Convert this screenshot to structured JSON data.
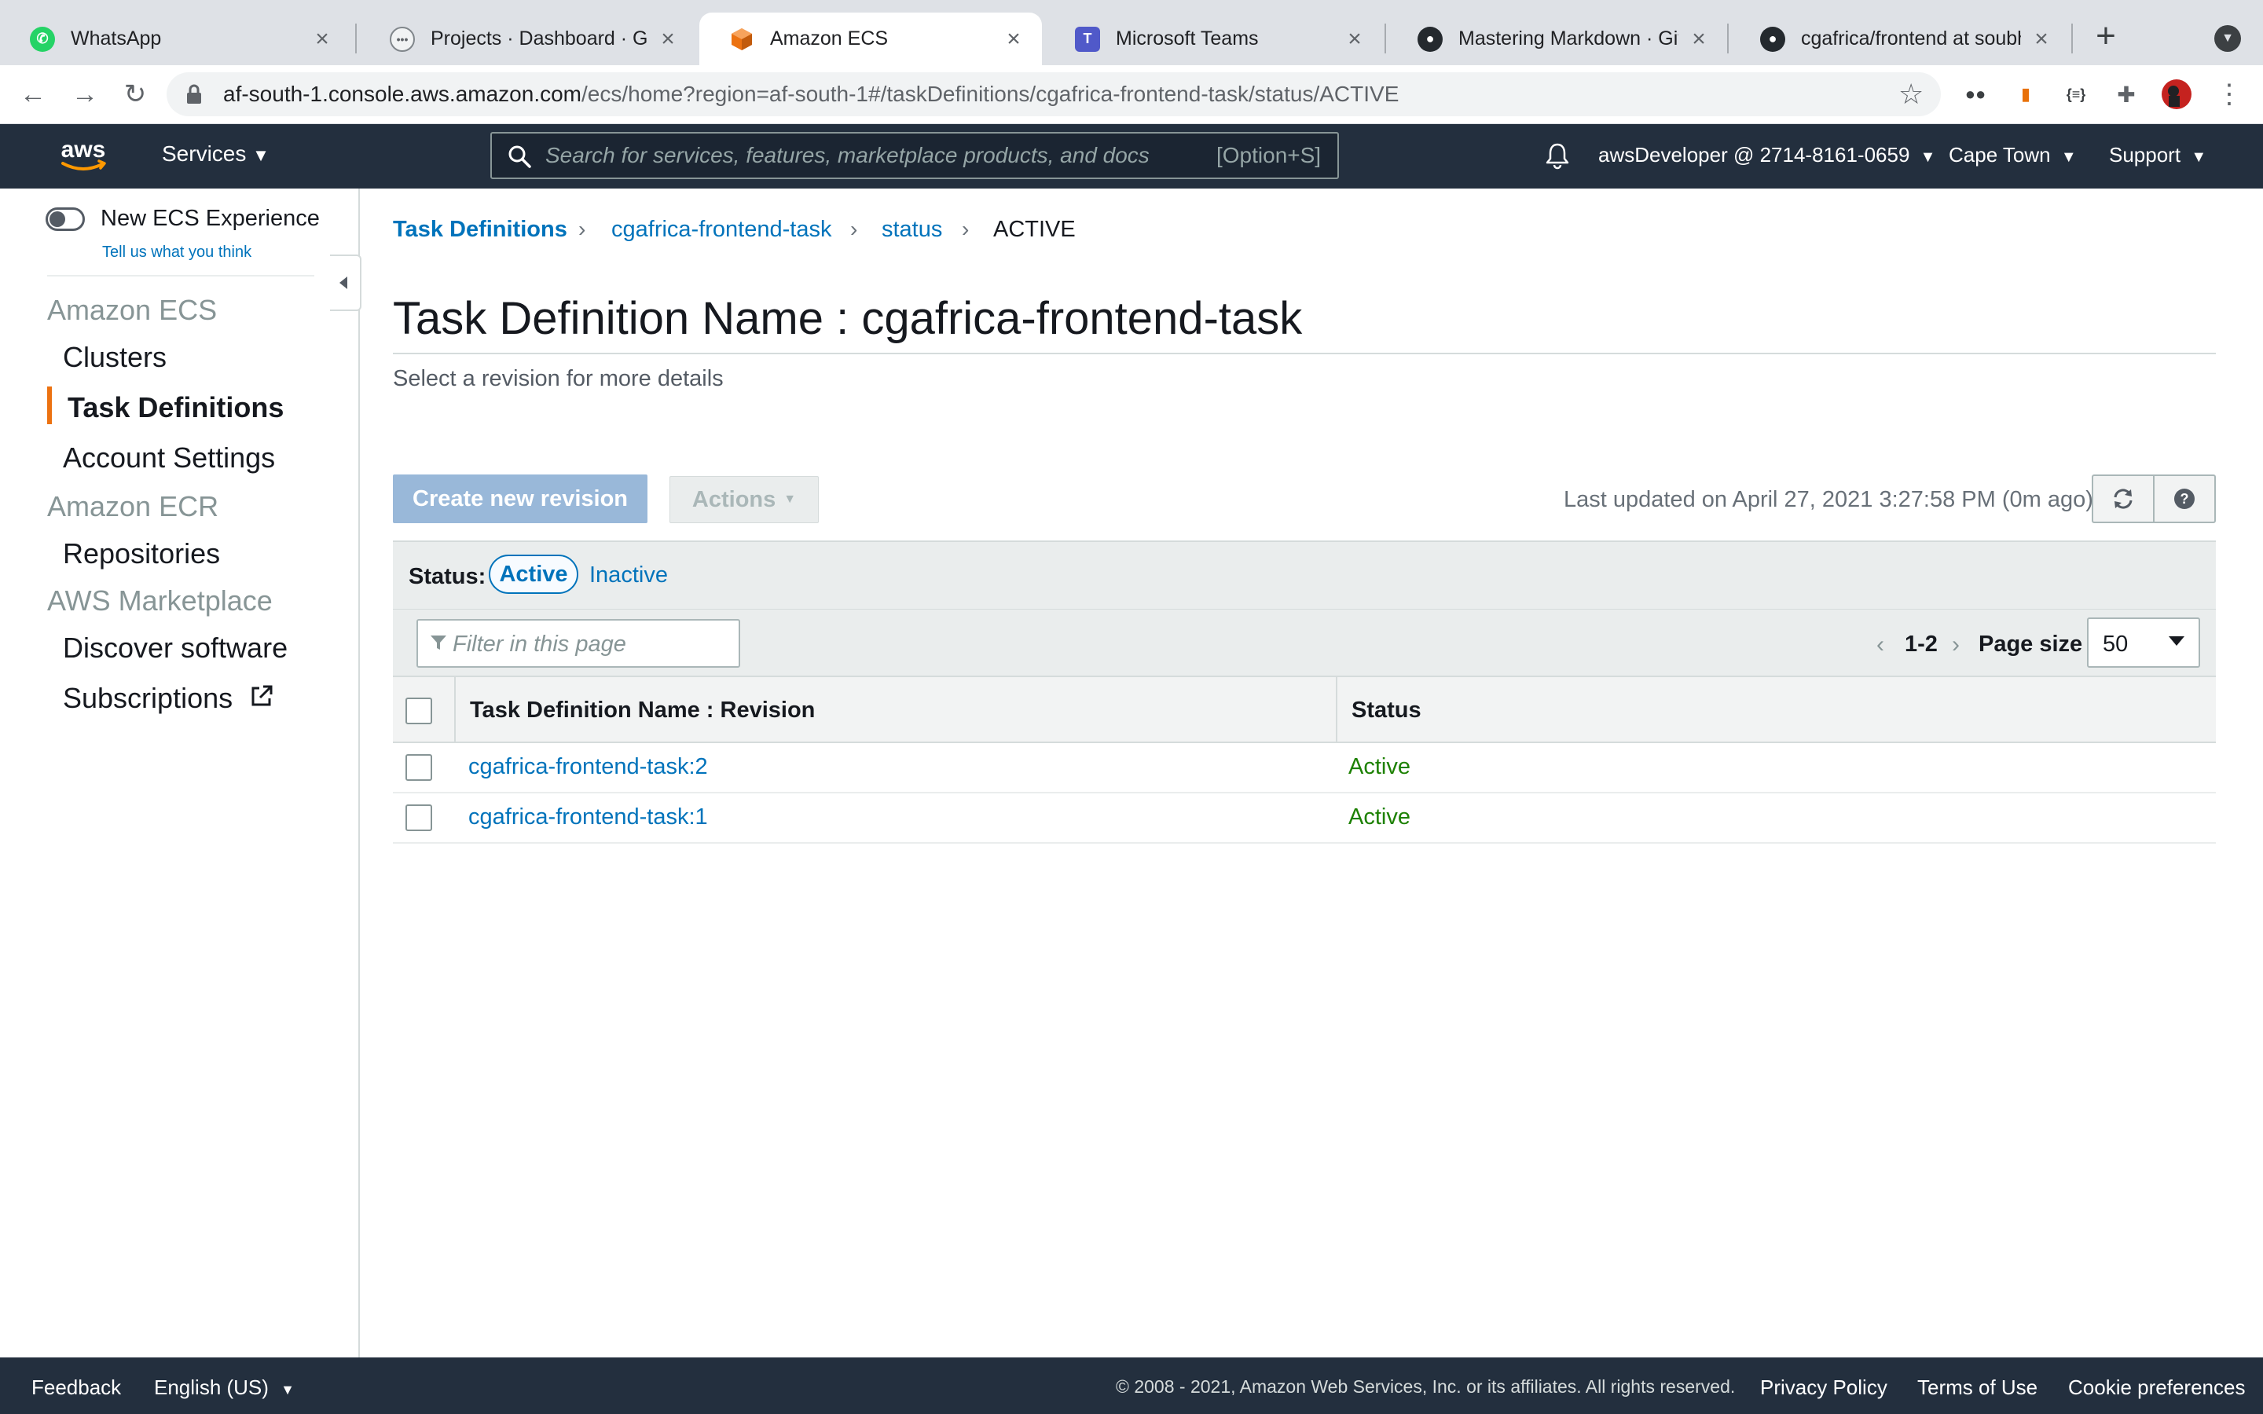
{
  "browser": {
    "tabs": [
      {
        "title": "WhatsApp",
        "icon": "whatsapp-icon",
        "color": "#25d366"
      },
      {
        "title": "Projects · Dashboard · GitLab",
        "icon": "gitlab-icon",
        "color": "#f1f3f4"
      },
      {
        "title": "Amazon ECS",
        "icon": "aws-ecs-icon",
        "color": "#ec7211",
        "active": true
      },
      {
        "title": "Microsoft Teams",
        "icon": "teams-icon",
        "color": "#5059c9"
      },
      {
        "title": "Mastering Markdown · GitHub",
        "icon": "github-icon",
        "color": "#24292e"
      },
      {
        "title": "cgafrica/frontend at soubhagya",
        "icon": "github-icon",
        "color": "#24292e"
      }
    ],
    "url_host": "af-south-1.console.aws.amazon.com",
    "url_path": "/ecs/home?region=af-south-1#/taskDefinitions/cgafrica-frontend-task/status/ACTIVE"
  },
  "aws_header": {
    "logo": "aws",
    "services_label": "Services",
    "search_placeholder": "Search for services, features, marketplace products, and docs",
    "search_shortcut": "[Option+S]",
    "account_label": "awsDeveloper @ 2714-8161-0659",
    "region_label": "Cape Town",
    "support_label": "Support"
  },
  "sidebar": {
    "new_experience_label": "New ECS Experience",
    "feedback_link": "Tell us what you think",
    "sections": [
      {
        "title": "Amazon ECS",
        "items": [
          "Clusters",
          "Task Definitions",
          "Account Settings"
        ]
      },
      {
        "title": "Amazon ECR",
        "items": [
          "Repositories"
        ]
      },
      {
        "title": "AWS Marketplace",
        "items": [
          "Discover software",
          "Subscriptions"
        ]
      }
    ],
    "active_item": "Task Definitions"
  },
  "breadcrumb": [
    "Task Definitions",
    "cgafrica-frontend-task",
    "status",
    "ACTIVE"
  ],
  "page": {
    "title": "Task Definition Name : cgafrica-frontend-task",
    "subtitle": "Select a revision for more details",
    "create_button": "Create new revision",
    "actions_button": "Actions",
    "last_updated": "Last updated on April 27, 2021 3:27:58 PM (0m ago)"
  },
  "status_filter": {
    "label": "Status:",
    "active": "Active",
    "inactive": "Inactive"
  },
  "table": {
    "filter_placeholder": "Filter in this page",
    "page_range": "1-2",
    "page_size_label": "Page size",
    "page_size": "50",
    "columns": [
      "Task Definition Name : Revision",
      "Status"
    ],
    "rows": [
      {
        "name": "cgafrica-frontend-task:2",
        "status": "Active"
      },
      {
        "name": "cgafrica-frontend-task:1",
        "status": "Active"
      }
    ]
  },
  "footer": {
    "feedback": "Feedback",
    "language": "English (US)",
    "copyright": "© 2008 - 2021, Amazon Web Services, Inc. or its affiliates. All rights reserved.",
    "links": [
      "Privacy Policy",
      "Terms of Use",
      "Cookie preferences"
    ]
  }
}
